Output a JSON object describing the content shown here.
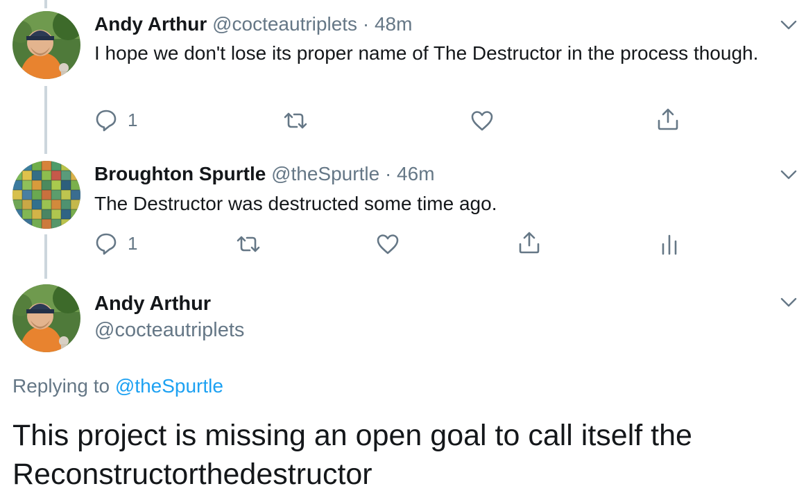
{
  "tweets": [
    {
      "name": "Andy Arthur",
      "handle": "@cocteautriplets",
      "separator": "·",
      "time": "48m",
      "text": "I hope we don't lose its proper name of The Destructor in the process though.",
      "reply_count": "1"
    },
    {
      "name": "Broughton Spurtle",
      "handle": "@theSpurtle",
      "separator": "·",
      "time": "46m",
      "text": "The Destructor was destructed some time ago.",
      "reply_count": "1"
    }
  ],
  "main_tweet": {
    "name": "Andy Arthur",
    "handle": "@cocteautriplets",
    "replying_prefix": "Replying to",
    "replying_to": "@theSpurtle",
    "text": "This project is missing an open goal to call itself the Reconstructorthedestructor"
  },
  "icons": {
    "reply": "reply-icon",
    "retweet": "retweet-icon",
    "like": "heart-icon",
    "share": "share-icon",
    "analytics": "analytics-icon",
    "more": "chevron-down-icon"
  },
  "colors": {
    "text": "#14171a",
    "secondary": "#657786",
    "link": "#1da1f2",
    "thread_line": "#ccd6dd"
  }
}
